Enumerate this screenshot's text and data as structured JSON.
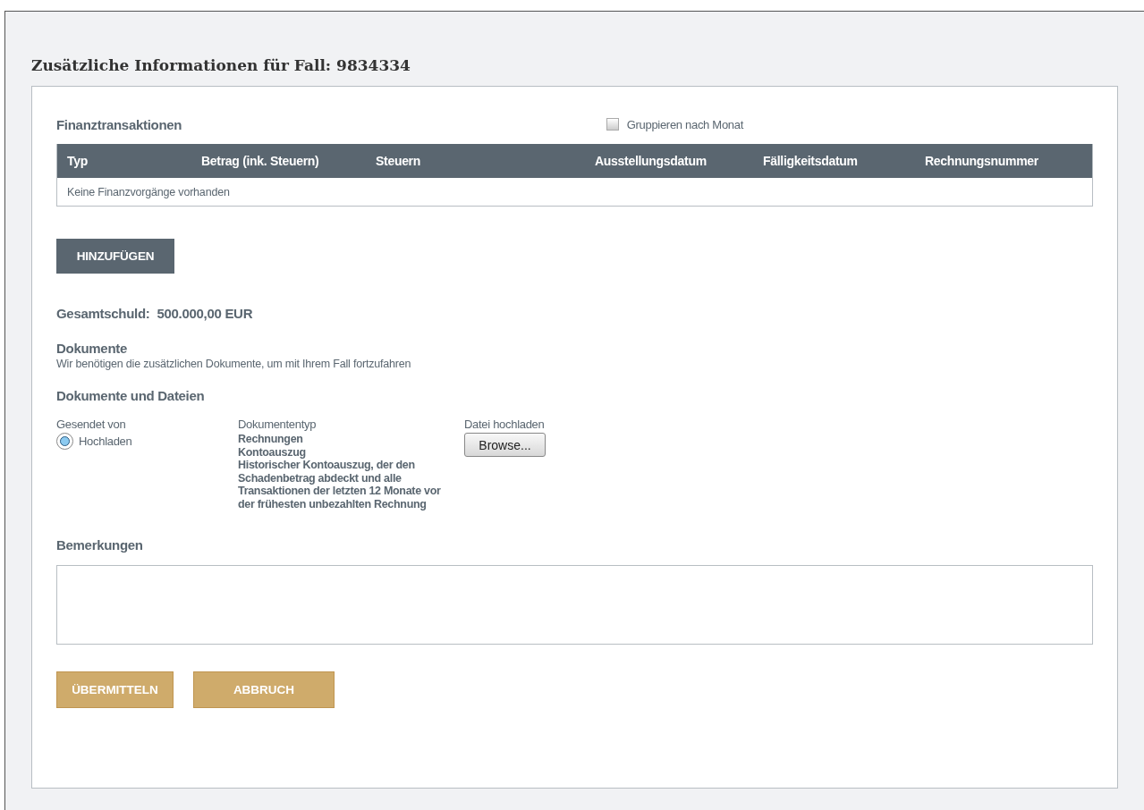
{
  "title": "Zusätzliche Informationen für Fall: 9834334",
  "transactions": {
    "heading": "Finanztransaktionen",
    "group_by_month": {
      "label": "Gruppieren nach Monat",
      "checked": false
    },
    "columns": [
      "Typ",
      "Betrag (ink. Steuern)",
      "Steuern",
      "Ausstellungsdatum",
      "Fälligkeitsdatum",
      "Rechnungsnummer"
    ],
    "empty_message": "Keine Finanzvorgänge vorhanden",
    "add_button": "HINZUFÜGEN"
  },
  "total": {
    "label": "Gesamtschuld:",
    "value": "500.000,00 EUR"
  },
  "documents": {
    "heading": "Dokumente",
    "description": "Wir benötigen die zusätzlichen Dokumente, um mit Ihrem Fall fortzufahren"
  },
  "files": {
    "heading": "Dokumente und Dateien",
    "sent_by": {
      "label": "Gesendet von",
      "options": [
        {
          "label": "Hochladen",
          "selected": true
        }
      ]
    },
    "document_type": {
      "label": "Dokumententyp",
      "items": [
        "Rechnungen",
        "Kontoauszug",
        "Historischer Kontoauszug, der den Schadenbetrag abdeckt und alle Transaktionen der letzten 12 Monate vor der frühesten unbezahlten Rechnung"
      ]
    },
    "upload": {
      "label": "Datei hochladen",
      "button": "Browse..."
    }
  },
  "remarks": {
    "heading": "Bemerkungen"
  },
  "actions": [
    "ÜBERMITTELN",
    "ABBRUCH"
  ]
}
